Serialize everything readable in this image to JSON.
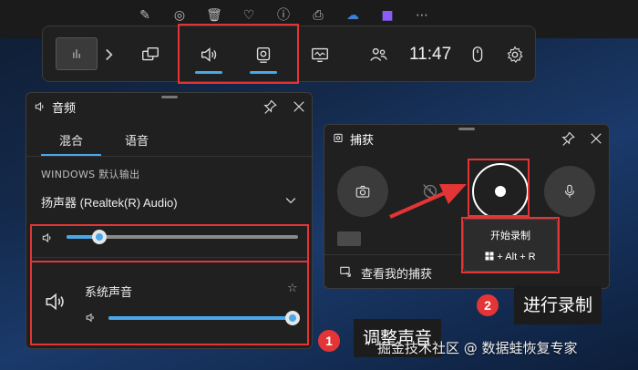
{
  "top_toolbar": {
    "icons": [
      "edit-image-icon",
      "circle-icon",
      "trash-icon",
      "heart-icon",
      "info-icon",
      "print-icon",
      "cloud-icon",
      "app-icon",
      "more-icon"
    ]
  },
  "game_bar": {
    "time": "11:47",
    "items": [
      "widget-menu-icon",
      "chevron-right-icon",
      "performance-icon",
      "audio-icon",
      "capture-icon",
      "resources-icon",
      "social-icon",
      "mouse-icon",
      "settings-icon"
    ]
  },
  "audio_panel": {
    "title": "音频",
    "tabs": [
      {
        "label": "混合",
        "active": true
      },
      {
        "label": "语音",
        "active": false
      }
    ],
    "section_label": "WINDOWS 默认输出",
    "device": "扬声器 (Realtek(R) Audio)",
    "master_volume": 0.14,
    "app": {
      "name": "系统声音",
      "volume": 0.97
    }
  },
  "capture_panel": {
    "title": "捕获",
    "view_captures": "查看我的捕获",
    "tooltip": {
      "title": "开始录制",
      "shortcut": "+ Alt + R"
    }
  },
  "annotations": {
    "step1": {
      "number": "1",
      "label": "调整声音"
    },
    "step2": {
      "number": "2",
      "label": "进行录制"
    },
    "accent_color": "#e33535"
  },
  "watermark": "掘金技术社区 @ 数据蛙恢复专家"
}
